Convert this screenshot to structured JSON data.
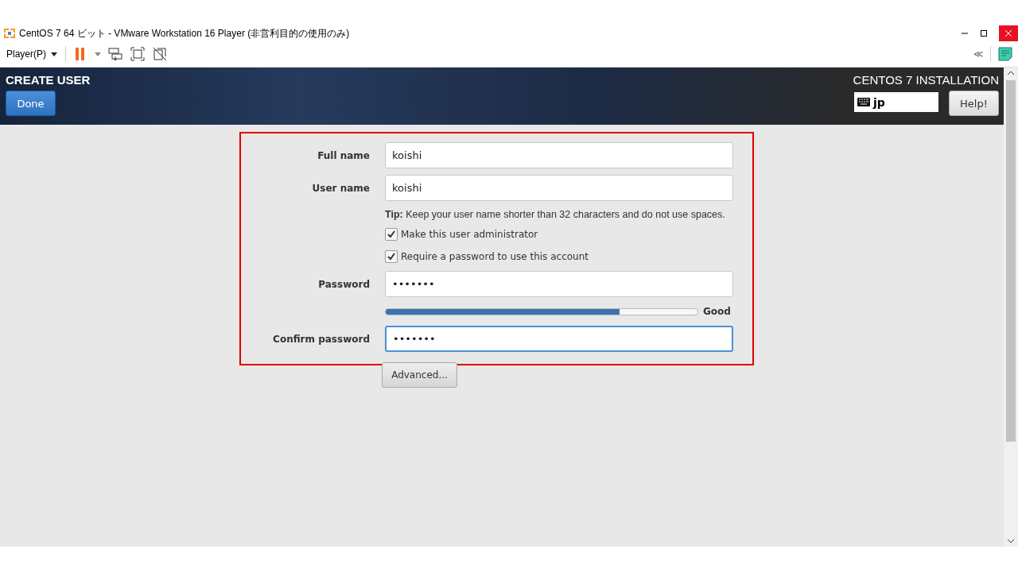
{
  "window": {
    "title": "CentOS 7 64 ビット - VMware Workstation 16 Player (非営利目的の使用のみ)"
  },
  "toolbar": {
    "player_menu": "Player(P)",
    "collapse": "≪"
  },
  "header": {
    "title": "CREATE USER",
    "done": "Done",
    "product": "CENTOS 7 INSTALLATION",
    "keyboard_layout": "jp",
    "help": "Help!"
  },
  "form": {
    "highlighted": true,
    "fields": [
      {
        "kind": "text",
        "label": "Full name",
        "value": "koishi",
        "focused": false
      },
      {
        "kind": "text",
        "label": "User name",
        "value": "koishi",
        "focused": false
      },
      {
        "kind": "tip",
        "text": "**Tip:** Keep your user name shorter than 32 characters and do not use spaces."
      },
      {
        "kind": "checkbox",
        "label": "Make this user administrator",
        "checked": true
      },
      {
        "kind": "checkbox",
        "label": "Require a password to use this account",
        "checked": true
      },
      {
        "kind": "text",
        "label": "Password",
        "value": "•••••••",
        "focused": false
      },
      {
        "kind": "strength",
        "level": 0.75,
        "reading": "Good"
      },
      {
        "kind": "text",
        "label": "Confirm password",
        "value": "•••••••",
        "focused": true
      }
    ],
    "advanced": "Advanced..."
  }
}
